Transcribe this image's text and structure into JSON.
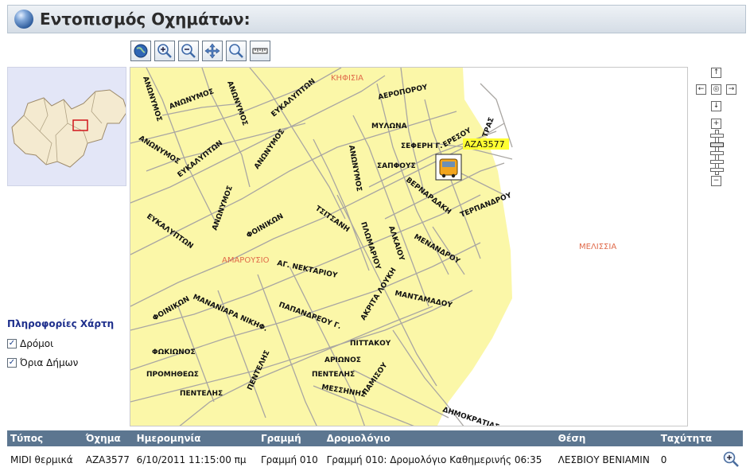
{
  "title": "Εντοπισμός Οχημάτων:",
  "toolbar": {
    "tools": [
      "globe-icon",
      "zoom-in-icon",
      "zoom-out-icon",
      "pan-icon",
      "zoom-icon",
      "ruler-icon"
    ]
  },
  "map": {
    "areas": {
      "kifisia": "ΚΗΦΙΣΙΑ",
      "marousi": "ΑΜΑΡΟΥΣΙΟ",
      "melissia": "ΜΕΛΙΣΣΙΑ"
    },
    "vehicle_label": "ΑΖΑ3577",
    "streets": {
      "s1": "ΑΝΩΝΥΜΟΣ",
      "s2": "ΑΝΩΝΥΜΟΣ",
      "s3": "ΑΝΩΝΥΜΟΣ",
      "s4": "ΕΥΚΑΛΥΠΤΩΝ",
      "s5": "ΑΕΡΟΠΟΡΟΥ",
      "s6": "ΜΥΛΩΝΑ",
      "s7": "ΣΕΦΕΡΗ Γ.",
      "s8": "ΕΡΕΣΟΥ",
      "s9": "ΤΡΑΣ",
      "s10": "ΑΝΩΝΥΜΟΣ",
      "s11": "ΕΥΚΑΛΥΠΤΩΝ",
      "s12": "ΑΝΩΝΥΜΟΣ",
      "s13": "ΣΑΠΦΟΥΣ",
      "s14": "ΑΝΩΝΥΜΟΣ",
      "s15": "ΑΝΩΝΥΜΟΣ",
      "s16": "ΒΕΡΝΑΡΔΑΚΗ",
      "s17": "ΤΕΡΠΑΝΔΡΟΥ",
      "s18": "ΤΣΙΤΣΑΝΗ",
      "s19": "ΦΟΙΝΙΚΩΝ",
      "s20": "ΕΥΚΑΛΥΠΤΩΝ",
      "s21": "ΠΛΩΜΑΡΙΟΥ",
      "s22": "ΑΛΚΑΙΟΥ",
      "s23": "ΜΕΝΑΝΔΡΟΥ",
      "s24": "ΑΓ. ΝΕΚΤΑΡΙΟΥ",
      "s25": "ΜΑΝΤΑΜΑΔΟΥ",
      "s26": "ΦΟΙΝΙΚΩΝ",
      "s27": "ΜΑΝΑΝΙΑΡΑ ΝΙΚΗΦ.",
      "s28": "ΠΑΠΑΝΔΡΕΟΥ Γ.",
      "s29": "ΑΚΡΙΤΑ ΛΟΥΚΗ",
      "s30": "ΠΙΤΤΑΚΟΥ",
      "s31": "ΦΩΚΙΩΝΟΣ",
      "s32": "ΠΕΝΤΕΛΗΣ",
      "s33": "ΑΡΙΩΝΟΣ",
      "s34": "ΠΡΟΜΗΘΕΩΣ",
      "s35": "ΠΕΝΤΕΛΗΣ",
      "s36": "ΜΕΣΣΗΝΗΣ",
      "s37": "ΠΑΜΙΣΟΥ",
      "s38": "ΠΕΝΤΕΛΗΣ",
      "s39": "ΔΗΜΟΚΡΑΤΙΑΣ"
    }
  },
  "legend": {
    "heading": "Πληροφορίες Χάρτη",
    "items": [
      {
        "label": "Δρόμοι",
        "checked": true
      },
      {
        "label": "Όρια Δήμων",
        "checked": true
      }
    ]
  },
  "table": {
    "headers": {
      "type": "Τύπος",
      "vehicle": "Όχημα",
      "date": "Ημερομηνία",
      "line": "Γραμμή",
      "route": "Δρομολόγιο",
      "position": "Θέση",
      "speed": "Ταχύτητα"
    },
    "rows": [
      {
        "type": "MIDI θερμικά",
        "vehicle": "ΑΖΑ3577",
        "date": "6/10/2011 11:15:00 πμ",
        "line": "Γραμμή 010",
        "route": "Γραμμή 010: Δρομολόγιο Καθημερινής 06:35",
        "position": "ΛΕΣΒΙΟΥ ΒΕΝΙΑΜΙΝ",
        "speed": "0"
      }
    ]
  },
  "colors": {
    "header_bg": "#5c7690",
    "map_bg": "#fbf7a8",
    "area_label": "#e06a4a",
    "legend_heading": "#1e2f8c"
  }
}
